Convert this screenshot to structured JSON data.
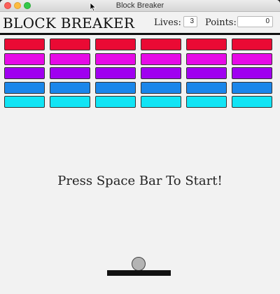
{
  "window": {
    "title": "Block Breaker"
  },
  "header": {
    "title": "BLOCK BREAKER",
    "lives_label": "Lives:",
    "lives_value": "3",
    "points_label": "Points:",
    "points_value": "0"
  },
  "bricks": {
    "columns": 6,
    "rows": [
      {
        "color": "#ea0a34"
      },
      {
        "color": "#e60ae6"
      },
      {
        "color": "#a000f0"
      },
      {
        "color": "#1a86ea"
      },
      {
        "color": "#12e4f5"
      }
    ]
  },
  "message": "Press Space Bar To Start!",
  "colors": {
    "background": "#f2f2f2",
    "paddle": "#111111",
    "ball": "#b4b4b4"
  }
}
